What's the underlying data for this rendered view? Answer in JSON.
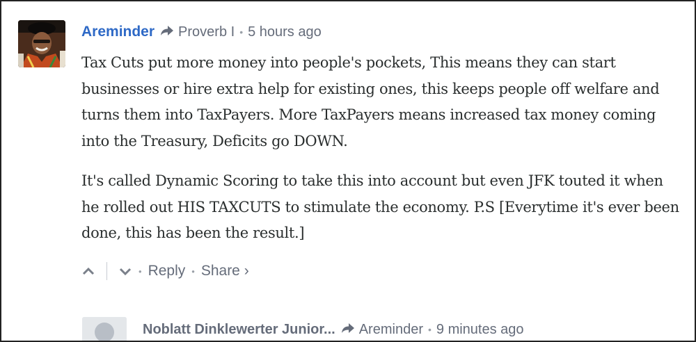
{
  "comment": {
    "author": "Areminder",
    "in_reply_to": "Proverb I",
    "time": "5 hours ago",
    "paragraphs": [
      "Tax Cuts put more money into people's pockets, This means they can start businesses or hire extra help for existing ones, this keeps people off welfare and turns them into TaxPayers. More TaxPayers means increased tax money coming into the Treasury, Deficits go DOWN.",
      "It's called Dynamic Scoring to take this into account but even JFK touted it when he rolled out HIS TAXCUTS to stimulate the economy. P.S [Everytime it's ever been done, this has been the result.]"
    ],
    "actions": {
      "reply": "Reply",
      "share": "Share",
      "share_chevron": "›"
    }
  },
  "reply_comment": {
    "author": "Noblatt Dinklewerter Junior...",
    "in_reply_to": "Areminder",
    "time": "9 minutes ago"
  },
  "icons": {
    "reply_arrow": "share-arrow-icon",
    "upvote": "chevron-up-icon",
    "downvote": "chevron-down-icon"
  },
  "colors": {
    "author": "#2e69c6",
    "meta": "#656c7a",
    "body_text": "#2a2e2e"
  }
}
